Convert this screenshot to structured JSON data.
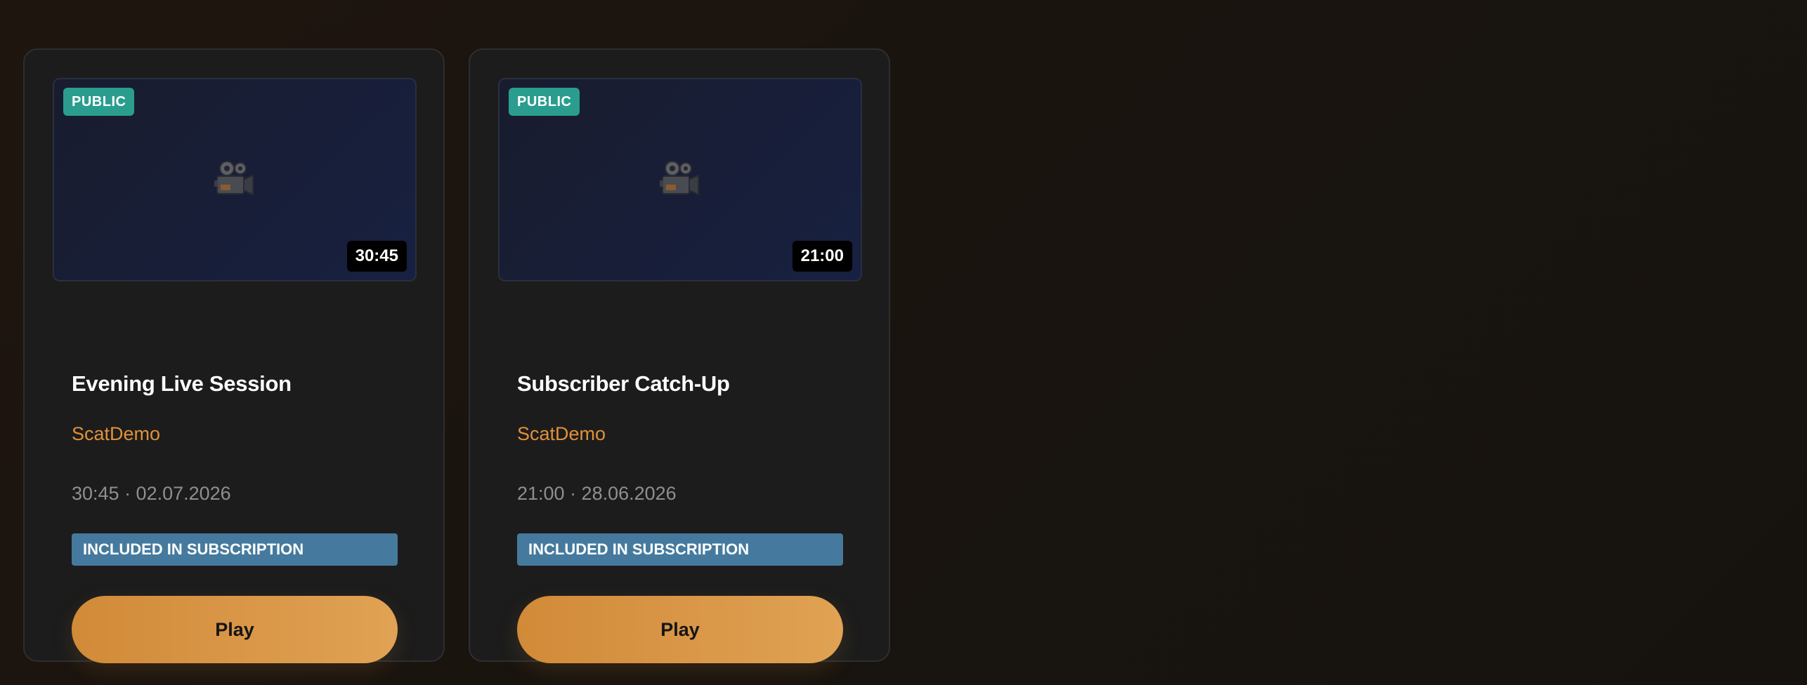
{
  "videos": [
    {
      "visibility": "PUBLIC",
      "duration": "30:45",
      "icon": "movie-camera-icon",
      "title": "Evening Live Session",
      "channel": "ScatDemo",
      "meta": "30:45 · 02.07.2026",
      "access": "INCLUDED IN SUBSCRIPTION",
      "action": "Play"
    },
    {
      "visibility": "PUBLIC",
      "duration": "21:00",
      "icon": "movie-camera-icon",
      "title": "Subscriber Catch-Up",
      "channel": "ScatDemo",
      "meta": "21:00 · 28.06.2026",
      "access": "INCLUDED IN SUBSCRIPTION",
      "action": "Play"
    }
  ],
  "colors": {
    "accent": "#e0913a",
    "public_badge": "#2a9d8f",
    "subscription_badge": "#457a9e",
    "card_bg": "#1c1c1c"
  }
}
